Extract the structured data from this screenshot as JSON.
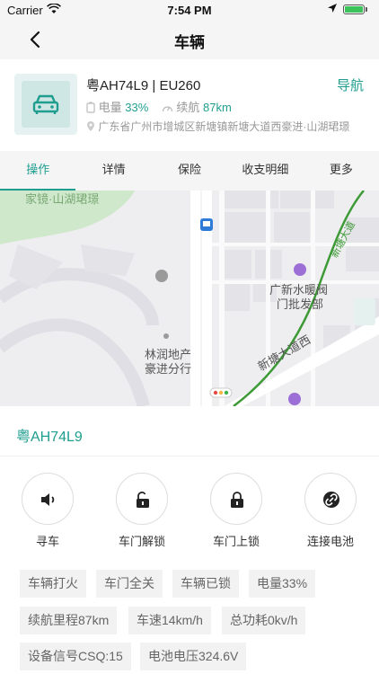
{
  "status_bar": {
    "carrier": "Carrier",
    "time": "7:54 PM"
  },
  "nav": {
    "title": "车辆"
  },
  "vehicle": {
    "plate_model": "粤AH74L9 | EU260",
    "navigate_label": "导航",
    "battery_label": "电量",
    "battery_value": "33%",
    "range_label": "续航",
    "range_value": "87km",
    "address": "广东省广州市增城区新塘镇新塘大道西豪进·山湖珺璟"
  },
  "tabs": [
    "操作",
    "详情",
    "保险",
    "收支明细",
    "更多"
  ],
  "map": {
    "labels": {
      "top_left": "家镜·山湖珺璟",
      "poi_shop_line1": "广新水暖阀",
      "poi_shop_line2": "门批发部",
      "poi_estate_line1": "林润地产",
      "poi_estate_line2": "豪进分行",
      "road": "新塘大道西",
      "road_right": "新塘大道"
    }
  },
  "plate_header": "粤AH74L9",
  "actions": [
    {
      "label": "寻车",
      "icon": "speaker-icon"
    },
    {
      "label": "车门解锁",
      "icon": "unlock-icon"
    },
    {
      "label": "车门上锁",
      "icon": "lock-icon"
    },
    {
      "label": "连接电池",
      "icon": "link-icon"
    }
  ],
  "status_tags": [
    "车辆打火",
    "车门全关",
    "车辆已锁",
    "电量33%",
    "续航里程87km",
    "车速14km/h",
    "总功耗0kv/h",
    "设备信号CSQ:15",
    "电池电压324.6V"
  ],
  "colors": {
    "accent": "#1f9e8f",
    "bar_bg": "#f5f5f5",
    "tag_bg": "#f2f2f2"
  }
}
